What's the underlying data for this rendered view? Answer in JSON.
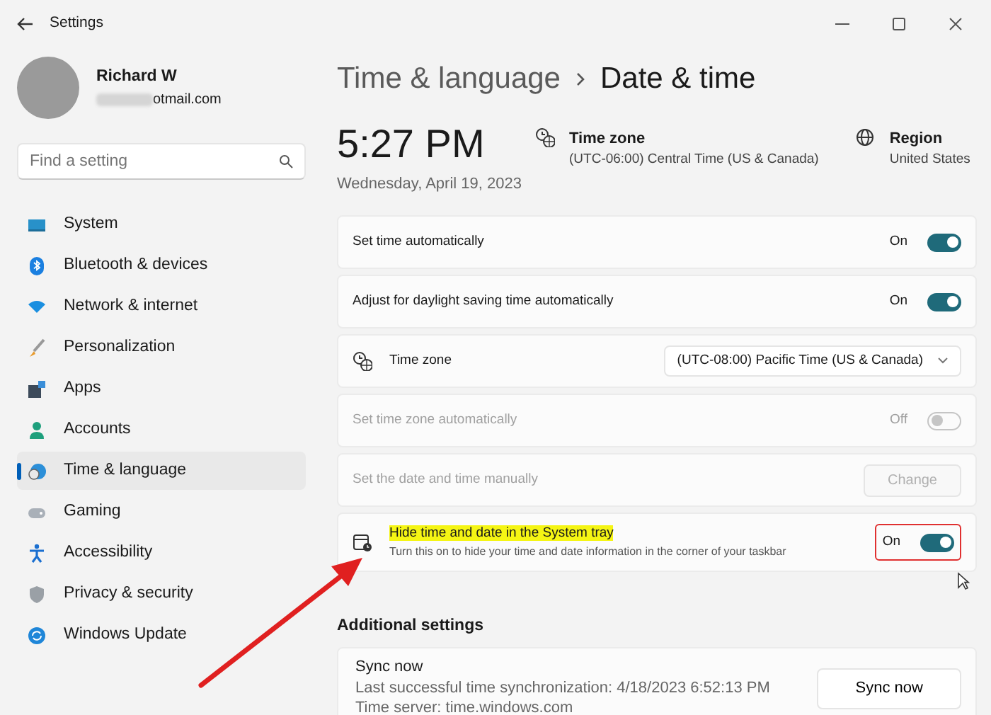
{
  "window": {
    "title": "Settings"
  },
  "user": {
    "name": "Richard W",
    "email": "otmail.com"
  },
  "search": {
    "placeholder": "Find a setting"
  },
  "sidebar": {
    "items": [
      {
        "label": "System",
        "selected": false
      },
      {
        "label": "Bluetooth & devices",
        "selected": false
      },
      {
        "label": "Network & internet",
        "selected": false
      },
      {
        "label": "Personalization",
        "selected": false
      },
      {
        "label": "Apps",
        "selected": false
      },
      {
        "label": "Accounts",
        "selected": false
      },
      {
        "label": "Time & language",
        "selected": true
      },
      {
        "label": "Gaming",
        "selected": false
      },
      {
        "label": "Accessibility",
        "selected": false
      },
      {
        "label": "Privacy & security",
        "selected": false
      },
      {
        "label": "Windows Update",
        "selected": false
      }
    ]
  },
  "breadcrumb": [
    "Time & language",
    "Date & time"
  ],
  "clock": {
    "time": "5:27 PM",
    "date": "Wednesday, April 19, 2023"
  },
  "summary": [
    {
      "title": "Time zone",
      "value": "(UTC-06:00) Central Time (US & Canada)"
    },
    {
      "title": "Region",
      "value": "United States"
    }
  ],
  "settings": [
    {
      "kind": "toggle",
      "label": "Set time automatically",
      "state_label": "On",
      "on": true,
      "disabled": false
    },
    {
      "kind": "toggle",
      "label": "Adjust for daylight saving time automatically",
      "state_label": "On",
      "on": true,
      "disabled": false
    },
    {
      "kind": "dropdown",
      "label": "Time zone",
      "value": "(UTC-08:00) Pacific Time (US & Canada)",
      "disabled": false
    },
    {
      "kind": "toggle",
      "label": "Set time zone automatically",
      "state_label": "Off",
      "on": false,
      "disabled": true
    },
    {
      "kind": "button",
      "label": "Set the date and time manually",
      "button": "Change",
      "disabled": true
    },
    {
      "kind": "toggle",
      "label": "Hide time and date in the System tray",
      "description": "Turn this on to hide your time and date information in the corner of your taskbar",
      "state_label": "On",
      "on": true,
      "disabled": false,
      "highlighted": true,
      "annotated": true
    }
  ],
  "additional": {
    "heading": "Additional settings",
    "sync": {
      "title": "Sync now",
      "lines": [
        "Last successful time synchronization: 4/18/2023 6:52:13 PM",
        "Time server: time.windows.com"
      ],
      "button": "Sync now"
    }
  }
}
